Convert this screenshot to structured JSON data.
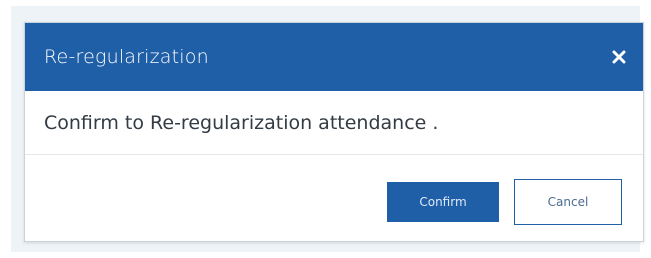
{
  "dialog": {
    "title": "Re-regularization",
    "message": "Confirm to Re-regularization attendance .",
    "confirm_label": "Confirm",
    "cancel_label": "Cancel",
    "close_icon": "close-icon"
  },
  "colors": {
    "header_bg": "#1f5fa8",
    "backdrop": "#eef3f7",
    "confirm_bg": "#1f5fa8",
    "cancel_border": "#1f5fa8"
  }
}
